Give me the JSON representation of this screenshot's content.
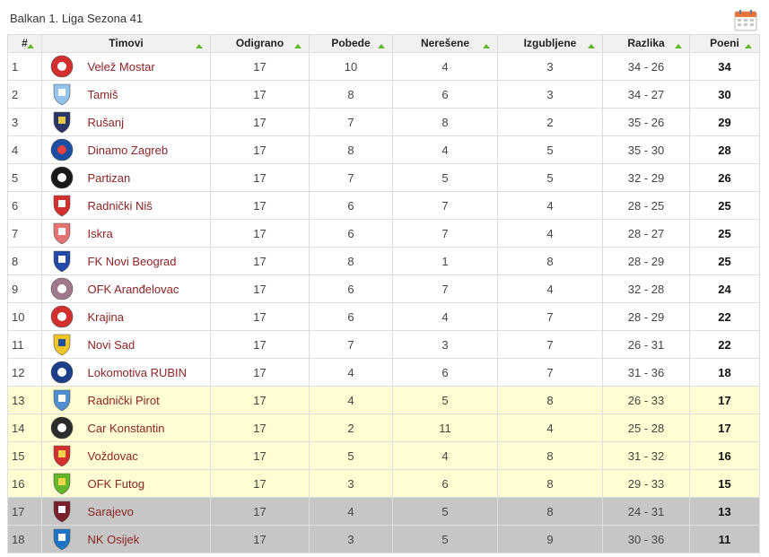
{
  "title": "Balkan 1. Liga Sezona 41",
  "columns": [
    "#",
    "Timovi",
    "Odigrano",
    "Pobede",
    "Nerešene",
    "Izgubljene",
    "Razlika",
    "Poeni"
  ],
  "rows": [
    {
      "rank": "1",
      "team": "Velež Mostar",
      "played": "17",
      "wins": "10",
      "draws": "4",
      "losses": "3",
      "diff": "34 - 26",
      "points": "34",
      "zone": "",
      "crest": {
        "shape": "circle",
        "fill": "#d32f2f",
        "accent": "#ffffff"
      }
    },
    {
      "rank": "2",
      "team": "Tamiš",
      "played": "17",
      "wins": "8",
      "draws": "6",
      "losses": "3",
      "diff": "34 - 27",
      "points": "30",
      "zone": "",
      "crest": {
        "shape": "shield",
        "fill": "#90c4ec",
        "accent": "#ffffff"
      }
    },
    {
      "rank": "3",
      "team": "Rušanj",
      "played": "17",
      "wins": "7",
      "draws": "8",
      "losses": "2",
      "diff": "35 - 26",
      "points": "29",
      "zone": "",
      "crest": {
        "shape": "shield",
        "fill": "#2b3566",
        "accent": "#e6c84a"
      }
    },
    {
      "rank": "4",
      "team": "Dinamo Zagreb",
      "played": "17",
      "wins": "8",
      "draws": "4",
      "losses": "5",
      "diff": "35 - 30",
      "points": "28",
      "zone": "",
      "crest": {
        "shape": "circle",
        "fill": "#1c4fa3",
        "accent": "#e94040"
      }
    },
    {
      "rank": "5",
      "team": "Partizan",
      "played": "17",
      "wins": "7",
      "draws": "5",
      "losses": "5",
      "diff": "32 - 29",
      "points": "26",
      "zone": "",
      "crest": {
        "shape": "circle",
        "fill": "#1a1a1a",
        "accent": "#ffffff"
      }
    },
    {
      "rank": "6",
      "team": "Radnički Niš",
      "played": "17",
      "wins": "6",
      "draws": "7",
      "losses": "4",
      "diff": "28 - 25",
      "points": "25",
      "zone": "",
      "crest": {
        "shape": "shield",
        "fill": "#d32f2f",
        "accent": "#ffffff"
      }
    },
    {
      "rank": "7",
      "team": "Iskra",
      "played": "17",
      "wins": "6",
      "draws": "7",
      "losses": "4",
      "diff": "28 - 27",
      "points": "25",
      "zone": "",
      "crest": {
        "shape": "shield",
        "fill": "#e57373",
        "accent": "#ffffff"
      }
    },
    {
      "rank": "8",
      "team": "FK Novi Beograd",
      "played": "17",
      "wins": "8",
      "draws": "1",
      "losses": "8",
      "diff": "28 - 29",
      "points": "25",
      "zone": "",
      "crest": {
        "shape": "shield",
        "fill": "#2249a8",
        "accent": "#ffffff"
      }
    },
    {
      "rank": "9",
      "team": "OFK Aranđelovac",
      "played": "17",
      "wins": "6",
      "draws": "7",
      "losses": "4",
      "diff": "32 - 28",
      "points": "24",
      "zone": "",
      "crest": {
        "shape": "circle",
        "fill": "#a07a8c",
        "accent": "#ffffff"
      }
    },
    {
      "rank": "10",
      "team": "Krajina",
      "played": "17",
      "wins": "6",
      "draws": "4",
      "losses": "7",
      "diff": "28 - 29",
      "points": "22",
      "zone": "",
      "crest": {
        "shape": "circle",
        "fill": "#d32f2f",
        "accent": "#ffffff"
      }
    },
    {
      "rank": "11",
      "team": "Novi Sad",
      "played": "17",
      "wins": "7",
      "draws": "3",
      "losses": "7",
      "diff": "26 - 31",
      "points": "22",
      "zone": "",
      "crest": {
        "shape": "shield",
        "fill": "#f2c522",
        "accent": "#1f4ea1"
      }
    },
    {
      "rank": "12",
      "team": "Lokomotiva RUBIN",
      "played": "17",
      "wins": "4",
      "draws": "6",
      "losses": "7",
      "diff": "31 - 36",
      "points": "18",
      "zone": "",
      "crest": {
        "shape": "circle",
        "fill": "#1b3f8a",
        "accent": "#ffffff"
      }
    },
    {
      "rank": "13",
      "team": "Radnički Pirot",
      "played": "17",
      "wins": "4",
      "draws": "5",
      "losses": "8",
      "diff": "26 - 33",
      "points": "17",
      "zone": "promo",
      "crest": {
        "shape": "shield",
        "fill": "#4f8fd0",
        "accent": "#ffffff"
      }
    },
    {
      "rank": "14",
      "team": "Car Konstantin",
      "played": "17",
      "wins": "2",
      "draws": "11",
      "losses": "4",
      "diff": "25 - 28",
      "points": "17",
      "zone": "promo",
      "crest": {
        "shape": "circle",
        "fill": "#2b2b2b",
        "accent": "#ffffff"
      }
    },
    {
      "rank": "15",
      "team": "Voždovac",
      "played": "17",
      "wins": "5",
      "draws": "4",
      "losses": "8",
      "diff": "31 - 32",
      "points": "16",
      "zone": "promo",
      "crest": {
        "shape": "shield",
        "fill": "#d32f2f",
        "accent": "#f3d64a"
      }
    },
    {
      "rank": "16",
      "team": "OFK Futog",
      "played": "17",
      "wins": "3",
      "draws": "6",
      "losses": "8",
      "diff": "29 - 33",
      "points": "15",
      "zone": "promo",
      "crest": {
        "shape": "shield",
        "fill": "#62b82a",
        "accent": "#f3d64a"
      }
    },
    {
      "rank": "17",
      "team": "Sarajevo",
      "played": "17",
      "wins": "4",
      "draws": "5",
      "losses": "8",
      "diff": "24 - 31",
      "points": "13",
      "zone": "rel",
      "crest": {
        "shape": "shield",
        "fill": "#7a1f2b",
        "accent": "#ffffff"
      }
    },
    {
      "rank": "18",
      "team": "NK Osijek",
      "played": "17",
      "wins": "3",
      "draws": "5",
      "losses": "9",
      "diff": "30 - 36",
      "points": "11",
      "zone": "rel",
      "crest": {
        "shape": "shield",
        "fill": "#1c74c4",
        "accent": "#ffffff"
      }
    }
  ],
  "colors": {
    "link": "#8b2424",
    "promo_row": "#fffdd1",
    "relegation_row": "#c6c6c6",
    "sort_arrow": "#62b82a",
    "header_bg": "#f1f1f1"
  },
  "icons": {
    "calendar": "calendar-icon",
    "sort": "sort-arrow-icon"
  }
}
